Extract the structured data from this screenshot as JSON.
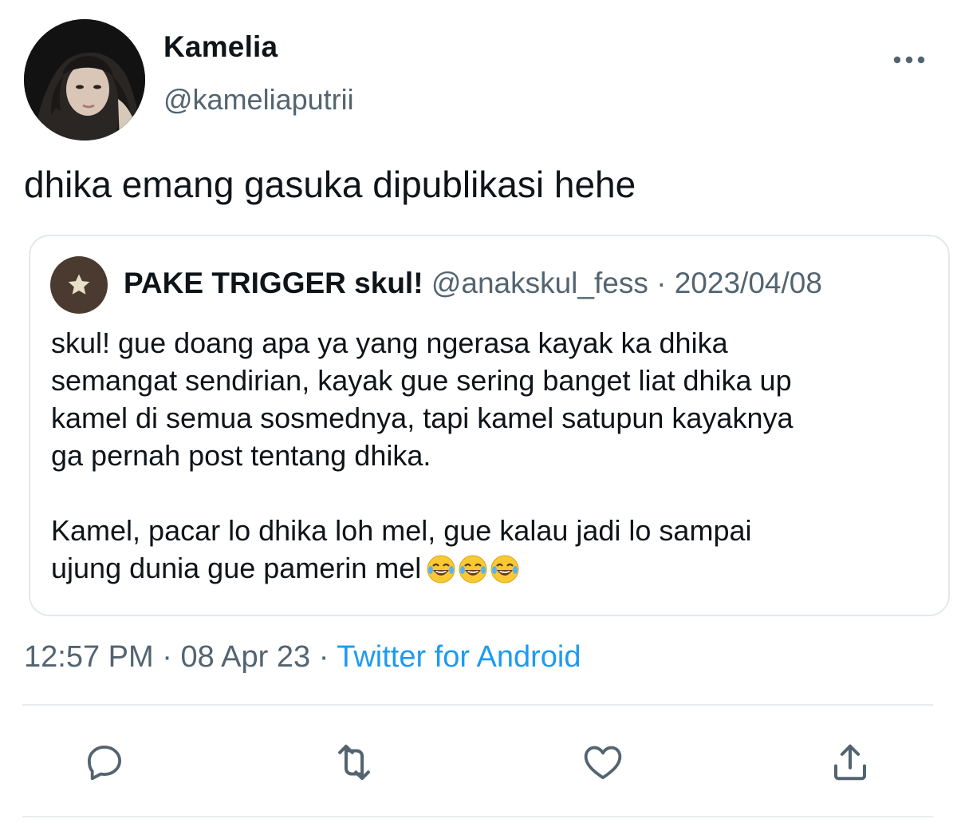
{
  "tweet": {
    "author": {
      "name": "Kamelia",
      "handle": "@kameliaputrii"
    },
    "text": "dhika emang gasuka dipublikasi hehe",
    "quote": {
      "author_name": "PAKE TRIGGER skul!",
      "author_handle": "@anakskul_fess",
      "separator": "·",
      "date": "2023/04/08",
      "body": "skul! gue doang apa ya yang ngerasa kayak ka dhika\nsemangat sendirian, kayak gue sering banget liat dhika up\nkamel di semua sosmednya, tapi kamel satupun kayaknya\nga pernah post tentang dhika.\n\nKamel, pacar lo dhika loh mel, gue kalau jadi lo sampai\nujung dunia gue pamerin mel",
      "emoji": [
        "face-with-tears-of-joy",
        "face-with-tears-of-joy",
        "face-with-tears-of-joy"
      ]
    },
    "meta": {
      "time": "12:57 PM",
      "sep1": "·",
      "date": "08 Apr 23",
      "sep2": "·",
      "source": "Twitter for Android"
    }
  },
  "icons": {
    "more": "more-dots-icon",
    "reply": "reply-icon",
    "retweet": "retweet-icon",
    "like": "heart-icon",
    "share": "share-icon",
    "quote_avatar": "star-icon"
  },
  "colors": {
    "text": "#0f1419",
    "secondary": "#536471",
    "link": "#1d9bf0",
    "border": "#e3e8ec",
    "quote_avatar_bg": "#4b3a2f"
  }
}
